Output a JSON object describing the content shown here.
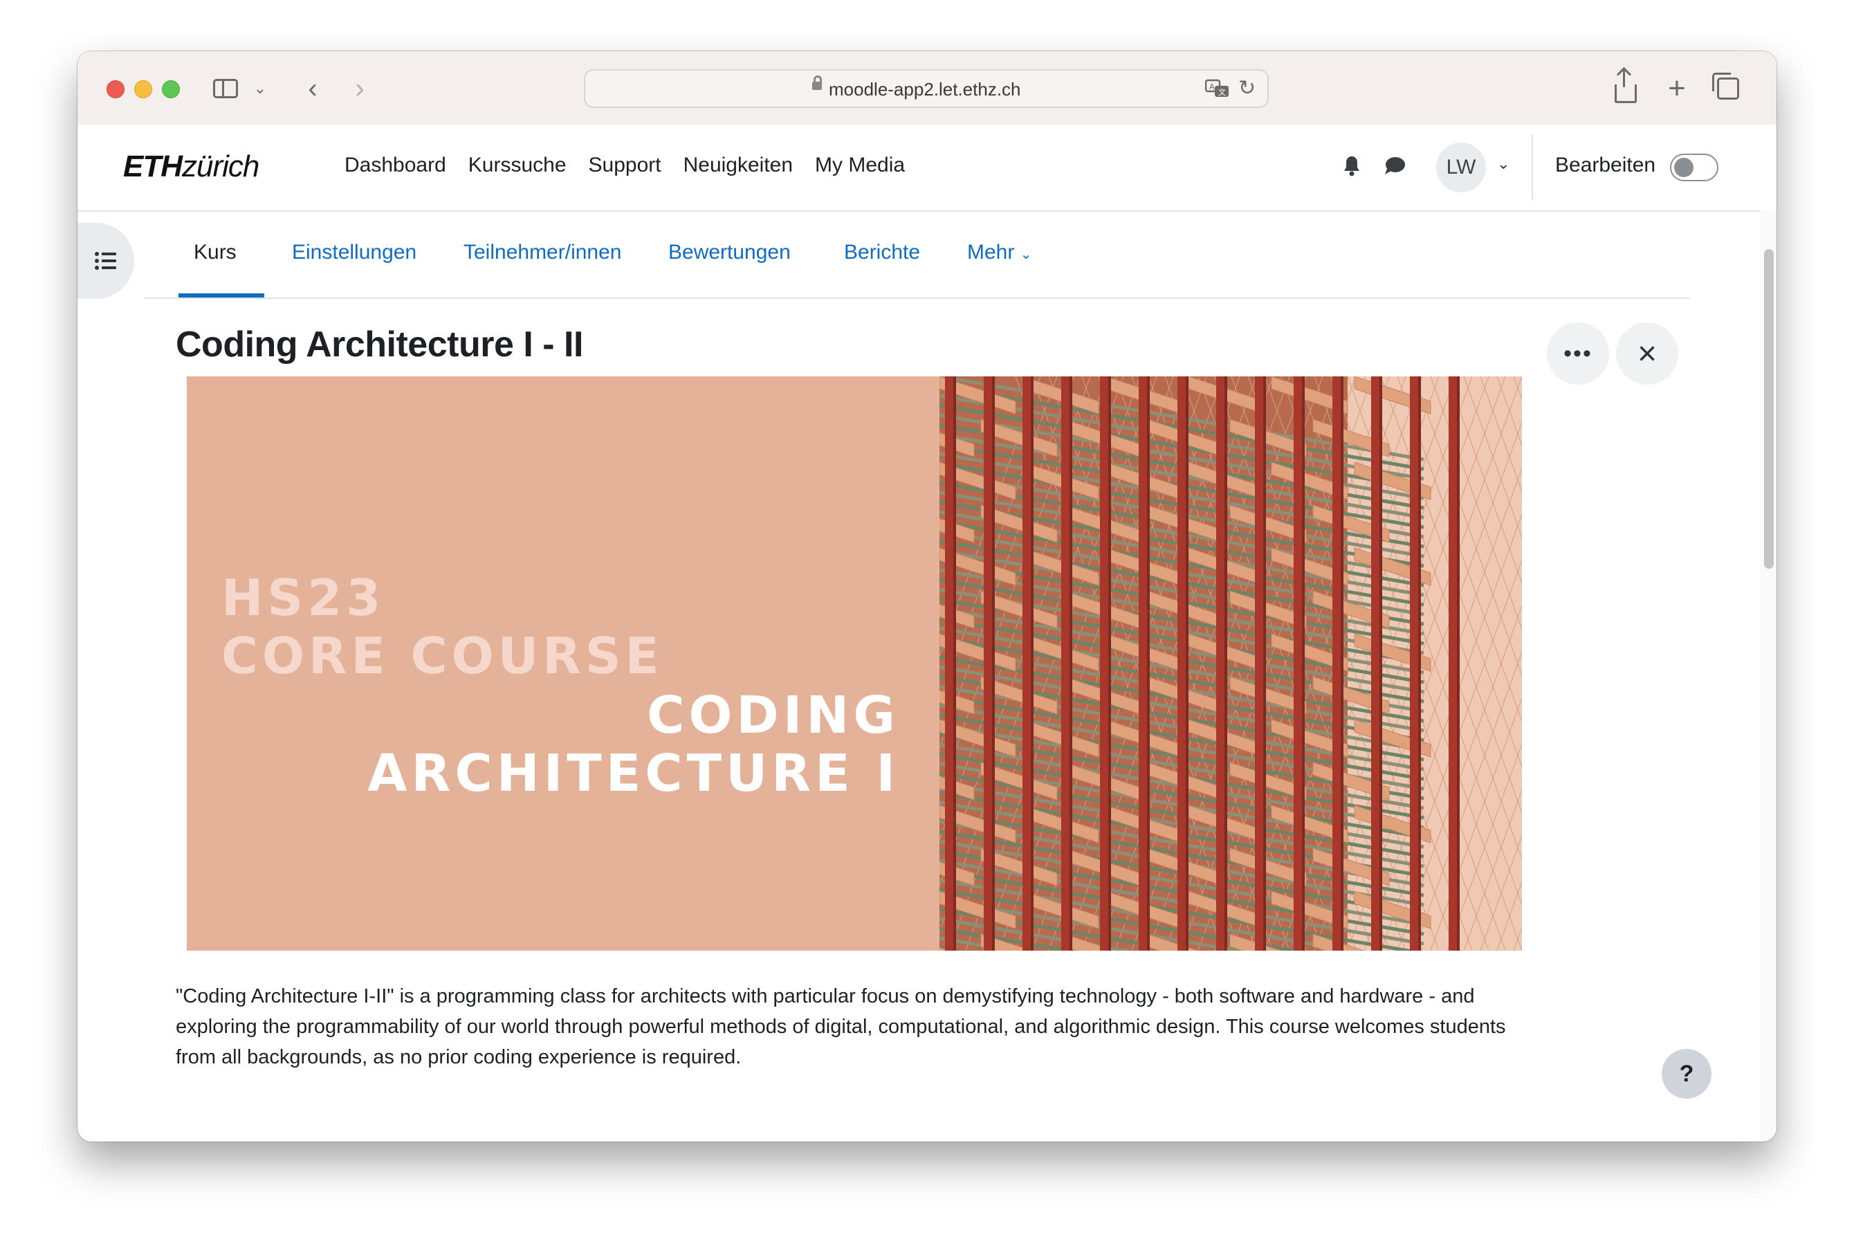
{
  "browser": {
    "url": "moodle-app2.let.ethz.ch"
  },
  "brand": {
    "logo_bold": "ETH",
    "logo_rest": "zürich"
  },
  "primary_nav": [
    "Dashboard",
    "Kurssuche",
    "Support",
    "Neuigkeiten",
    "My Media"
  ],
  "user": {
    "initials": "LW",
    "edit_mode_label": "Bearbeiten",
    "edit_mode_on": false
  },
  "secondary_nav": {
    "tabs": [
      "Kurs",
      "Einstellungen",
      "Teilnehmer/innen",
      "Bewertungen",
      "Berichte",
      "Mehr"
    ],
    "active": "Kurs"
  },
  "course": {
    "title": "Coding Architecture I - II",
    "banner": {
      "line1": "HS23",
      "line2": "CORE COURSE",
      "line3": "CODING",
      "line4": "ARCHITECTURE I"
    },
    "description": "\"Coding Architecture I-II\" is a programming class for architects with particular focus on demystifying technology - both software and hardware - and exploring the programmability of our world through powerful methods of digital, computational, and algorithmic design. This course welcomes students from all backgrounds, as no prior coding experience is required."
  },
  "help_label": "?",
  "colors": {
    "link": "#0f6cbf",
    "banner_bg": "#e4b299",
    "beam": "#a8382c",
    "plank": "#e0a27c"
  }
}
